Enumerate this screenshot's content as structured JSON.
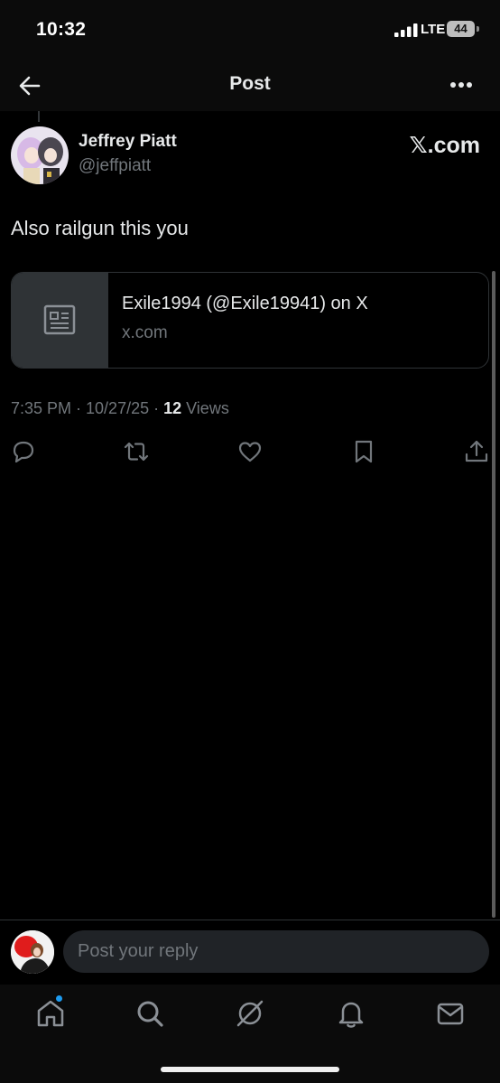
{
  "status_bar": {
    "time": "10:32",
    "network": "LTE",
    "battery": "44"
  },
  "header": {
    "title": "Post",
    "back_icon": "arrow-left-icon",
    "more_icon": "more-horizontal-icon"
  },
  "post": {
    "author_name": "Jeffrey Piatt",
    "author_handle": "@jeffpiatt",
    "source_label": "𝕏.com",
    "text": "Also railgun this you",
    "link_card": {
      "title": "Exile1994 (@Exile19941) on X",
      "domain": "x.com",
      "icon": "article-icon"
    },
    "meta": {
      "time_date": "7:35 PM · 10/27/25 · ",
      "views_count": "12",
      "views_label": " Views"
    },
    "actions": [
      "reply-icon",
      "repost-icon",
      "like-icon",
      "bookmark-icon",
      "share-icon"
    ]
  },
  "composer": {
    "placeholder": "Post your reply"
  },
  "bottom_nav": {
    "items": [
      "home-icon",
      "search-icon",
      "grok-icon",
      "notifications-icon",
      "messages-icon"
    ]
  },
  "colors": {
    "background": "#000000",
    "text_primary": "#e7e9ea",
    "text_secondary": "#71767b",
    "border": "#2f3336",
    "accent": "#1d9bf0"
  }
}
